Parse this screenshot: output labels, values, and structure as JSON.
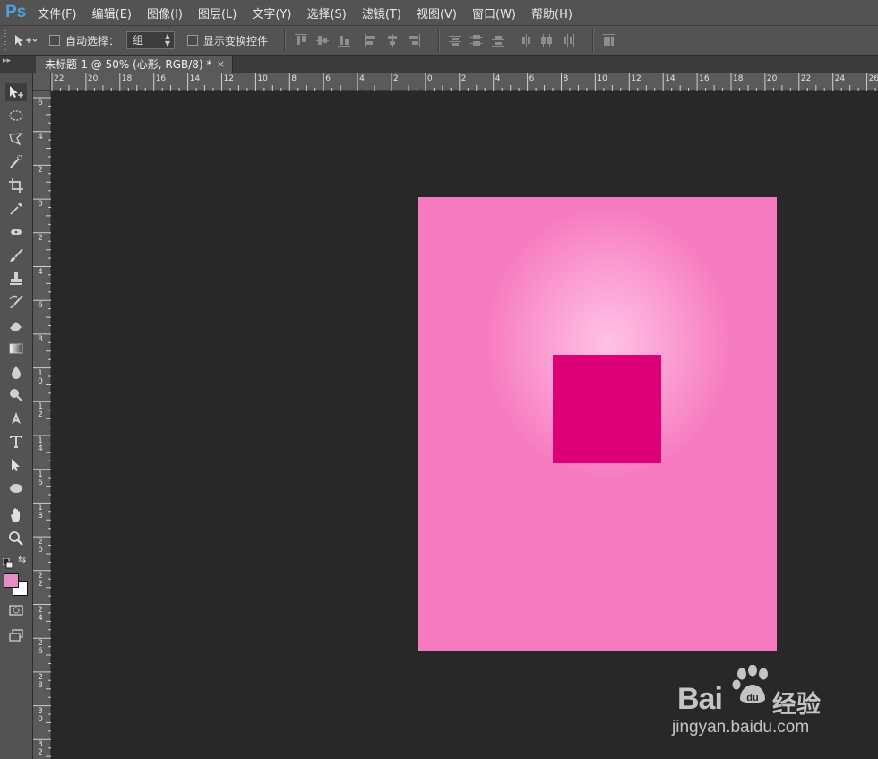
{
  "app": {
    "logo": "Ps"
  },
  "menu": [
    "文件(F)",
    "编辑(E)",
    "图像(I)",
    "图层(L)",
    "文字(Y)",
    "选择(S)",
    "滤镜(T)",
    "视图(V)",
    "窗口(W)",
    "帮助(H)"
  ],
  "options": {
    "auto_select_label": "自动选择：",
    "auto_select_value": "组",
    "show_transform_label": "显示变换控件"
  },
  "document": {
    "tab_title": "未标题-1 @ 50% (心形, RGB/8) *",
    "close_glyph": "×"
  },
  "rulers": {
    "top": [
      "22",
      "20",
      "18",
      "16",
      "14",
      "12",
      "10",
      "8",
      "6",
      "4",
      "2",
      "0",
      "2",
      "4",
      "6",
      "8",
      "10",
      "12",
      "14",
      "16",
      "18",
      "20",
      "22",
      "24",
      "26"
    ],
    "left": [
      "6",
      "4",
      "2",
      "0",
      "2",
      "4",
      "6",
      "8",
      "10",
      "12",
      "14",
      "16",
      "18",
      "20",
      "22",
      "24",
      "26",
      "28",
      "30",
      "32"
    ]
  },
  "tools": [
    "move-tool-icon",
    "marquee-tool-icon",
    "lasso-tool-icon",
    "quick-select-tool-icon",
    "crop-tool-icon",
    "eyedropper-tool-icon",
    "healing-tool-icon",
    "brush-tool-icon",
    "stamp-tool-icon",
    "history-brush-tool-icon",
    "eraser-tool-icon",
    "gradient-tool-icon",
    "blur-tool-icon",
    "dodge-tool-icon",
    "pen-tool-icon",
    "type-tool-icon",
    "path-select-tool-icon",
    "ellipse-tool-icon",
    "hand-tool-icon",
    "zoom-tool-icon"
  ],
  "colors": {
    "foreground": "#e28fc4",
    "background": "#ffffff",
    "canvas_fill": "#f67abf",
    "square_fill": "#de0076"
  },
  "watermark": {
    "brand": "Bai",
    "brand_tail": "du",
    "cn": "经验",
    "url": "jingyan.baidu.com"
  }
}
